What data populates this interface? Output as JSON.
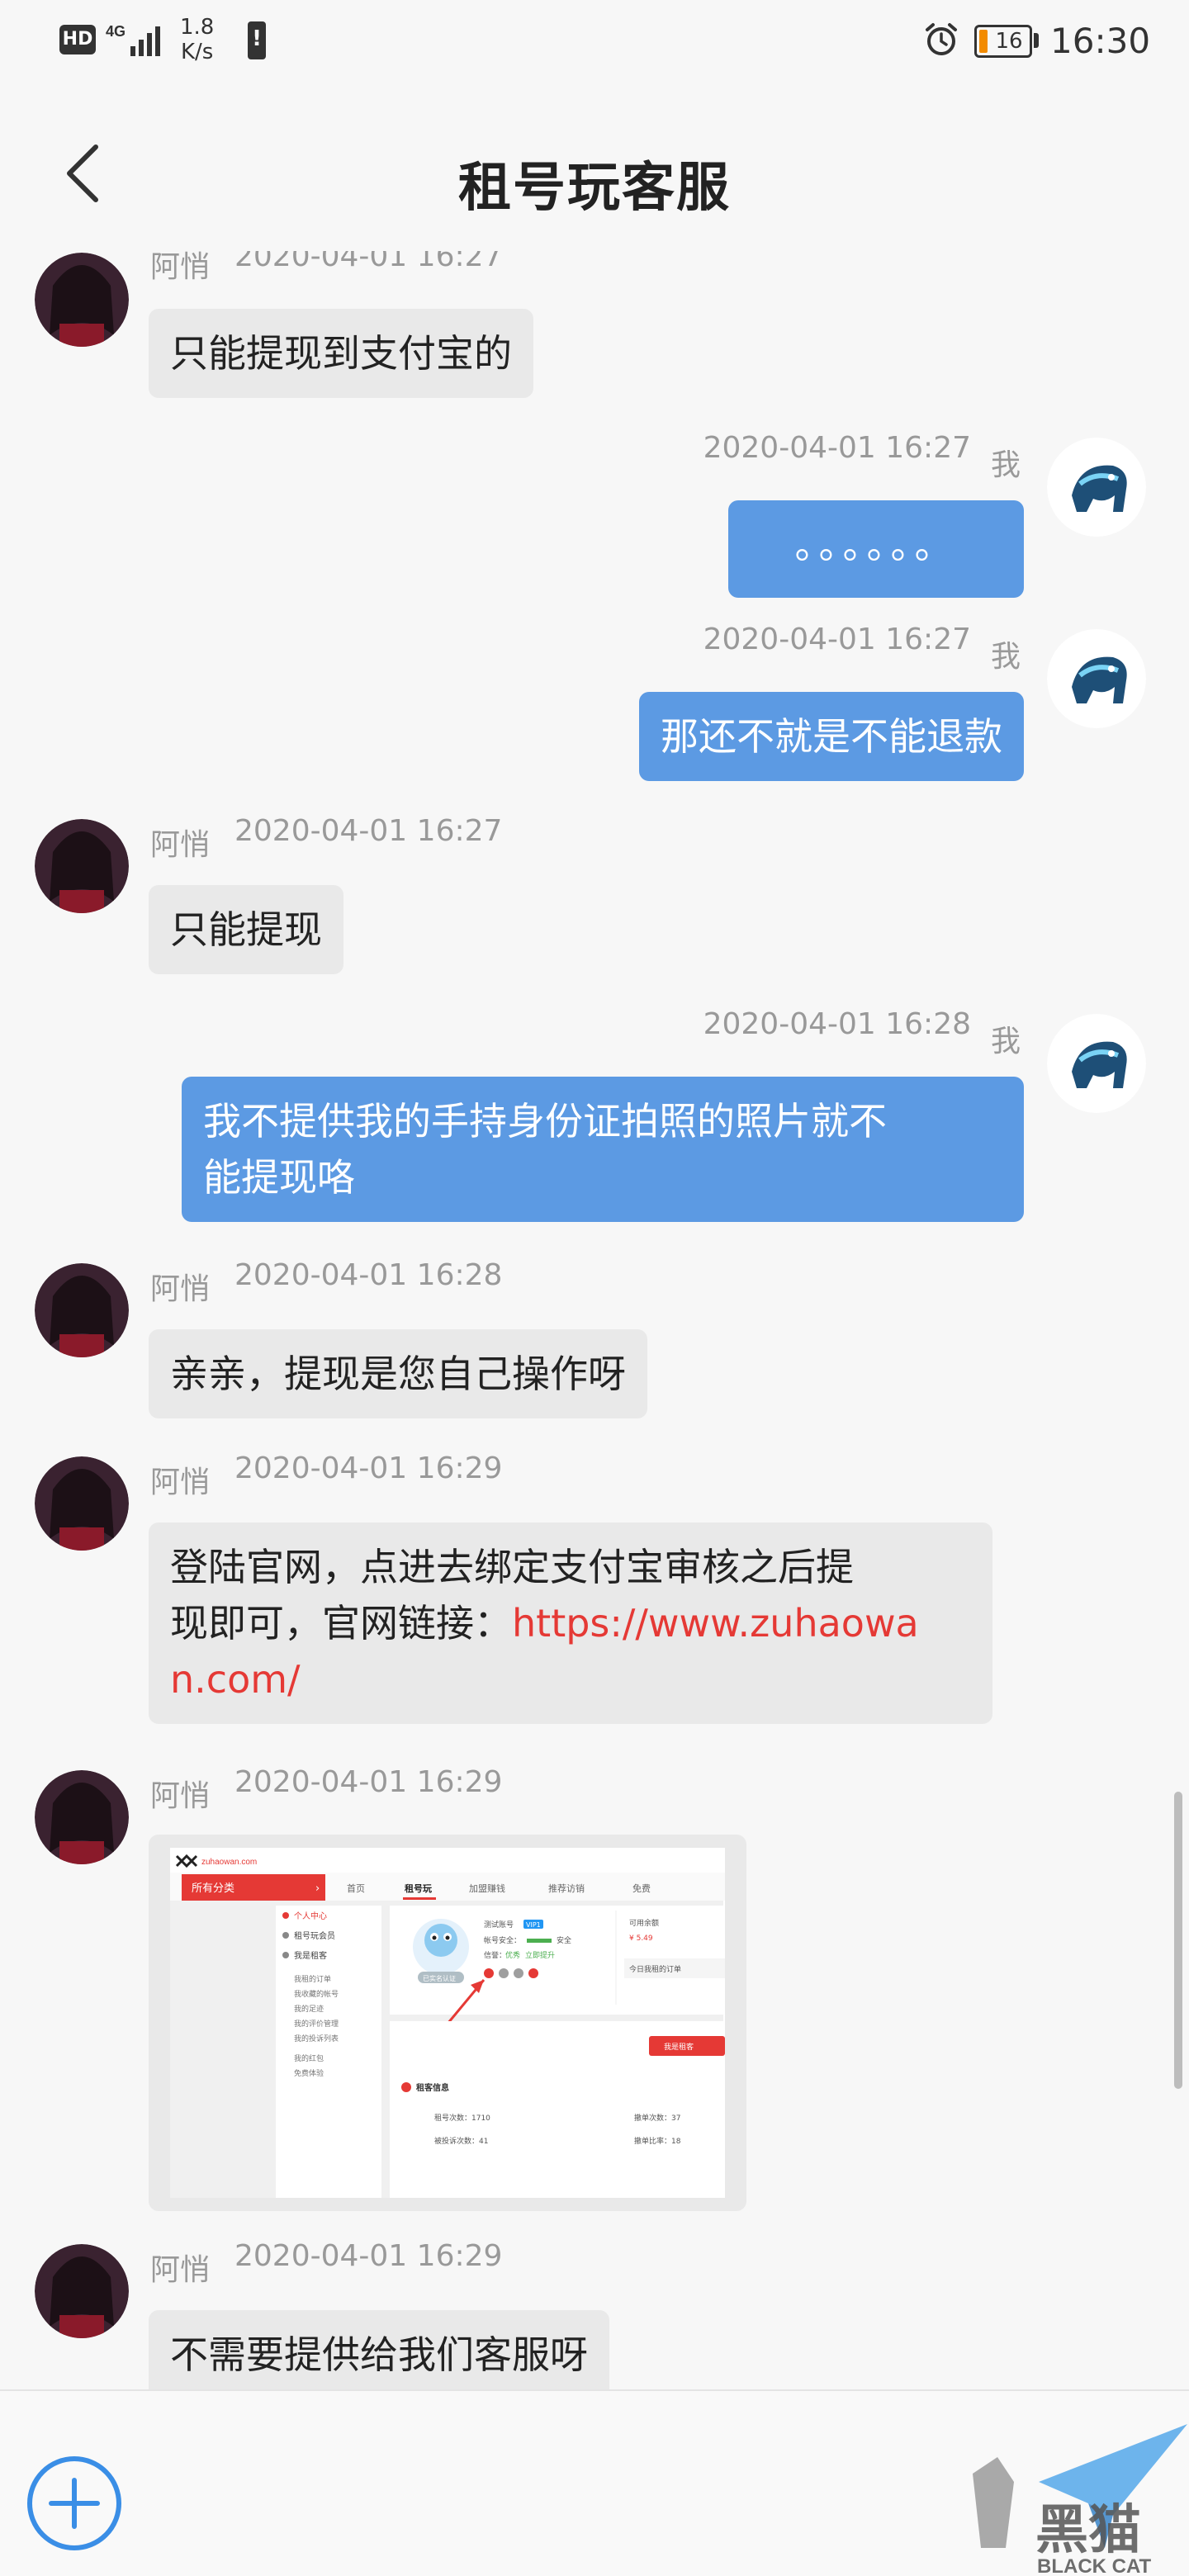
{
  "status_bar": {
    "hd": "HD",
    "network": "4G",
    "speed_value": "1.8",
    "speed_unit": "K/s",
    "battery": "16",
    "time": "16:30"
  },
  "header": {
    "title": "租号玩客服"
  },
  "messages": [
    {
      "from": "other",
      "sender": "阿悄",
      "time": "2020-04-01 16:27",
      "text": "只能提现到支付宝的"
    },
    {
      "from": "me",
      "sender": "我",
      "time": "2020-04-01 16:27",
      "text": "。。。。。。"
    },
    {
      "from": "me",
      "sender": "我",
      "time": "2020-04-01 16:27",
      "text": "那还不就是不能退款"
    },
    {
      "from": "other",
      "sender": "阿悄",
      "time": "2020-04-01 16:27",
      "text": "只能提现"
    },
    {
      "from": "me",
      "sender": "我",
      "time": "2020-04-01 16:28",
      "text_line1": "我不提供我的手持身份证拍照的照片就不",
      "text_line2": "能提现咯"
    },
    {
      "from": "other",
      "sender": "阿悄",
      "time": "2020-04-01 16:28",
      "text": "亲亲，提现是您自己操作呀"
    },
    {
      "from": "other",
      "sender": "阿悄",
      "time": "2020-04-01 16:29",
      "line1": "登陆官网，点进去绑定支付宝审核之后提",
      "line2_prefix": "现即可，官网链接：",
      "line2_link": "https://www.zuhaowa",
      "line3_link": "n.com/"
    },
    {
      "from": "other",
      "sender": "阿悄",
      "time": "2020-04-01 16:29",
      "type": "image"
    },
    {
      "from": "other",
      "sender": "阿悄",
      "time": "2020-04-01 16:29",
      "text": "不需要提供给我们客服呀"
    }
  ],
  "embedded_screenshot": {
    "site": "zuhaowan.com",
    "category": "所有分类",
    "nav": [
      "首页",
      "租号玩",
      "加盟赚钱",
      "推荐访销",
      "免费"
    ],
    "menu": [
      "个人中心",
      "租号玩会员",
      "我是租客",
      "我租的订单",
      "我收藏的帐号",
      "我的足迹",
      "我的评价管理",
      "我的投诉列表",
      "我的红包",
      "免费体验"
    ],
    "account_label": "测试账号",
    "vip_badge": "VIP1",
    "security_label": "帐号安全：",
    "security_value": "安全",
    "credit_label": "信誉：",
    "credit_value": "优秀",
    "credit_link": "立即提升",
    "balance_label": "可用余额",
    "balance_value": "¥ 5.49",
    "today_label": "今日我租的订单",
    "rent_btn": "我是租客",
    "section_title": "租客信息",
    "rent_count_label": "租号次数：1710",
    "refund_count_label": "被投诉次数：41",
    "withdraw_count_label": "撤单次数：37",
    "withdraw_rate_label": "撤单比率：18",
    "bind_badge": "已实名认证"
  },
  "colors": {
    "bubble_me": "#5c9ae3",
    "bubble_other": "#e9e9e9",
    "link": "#e53935",
    "accent_red": "#e53935"
  },
  "bottom_bar": {
    "add_icon": "plus-circle-icon"
  },
  "watermark": {
    "brand_cn": "黑猫",
    "brand_en": "BLACK CAT"
  }
}
